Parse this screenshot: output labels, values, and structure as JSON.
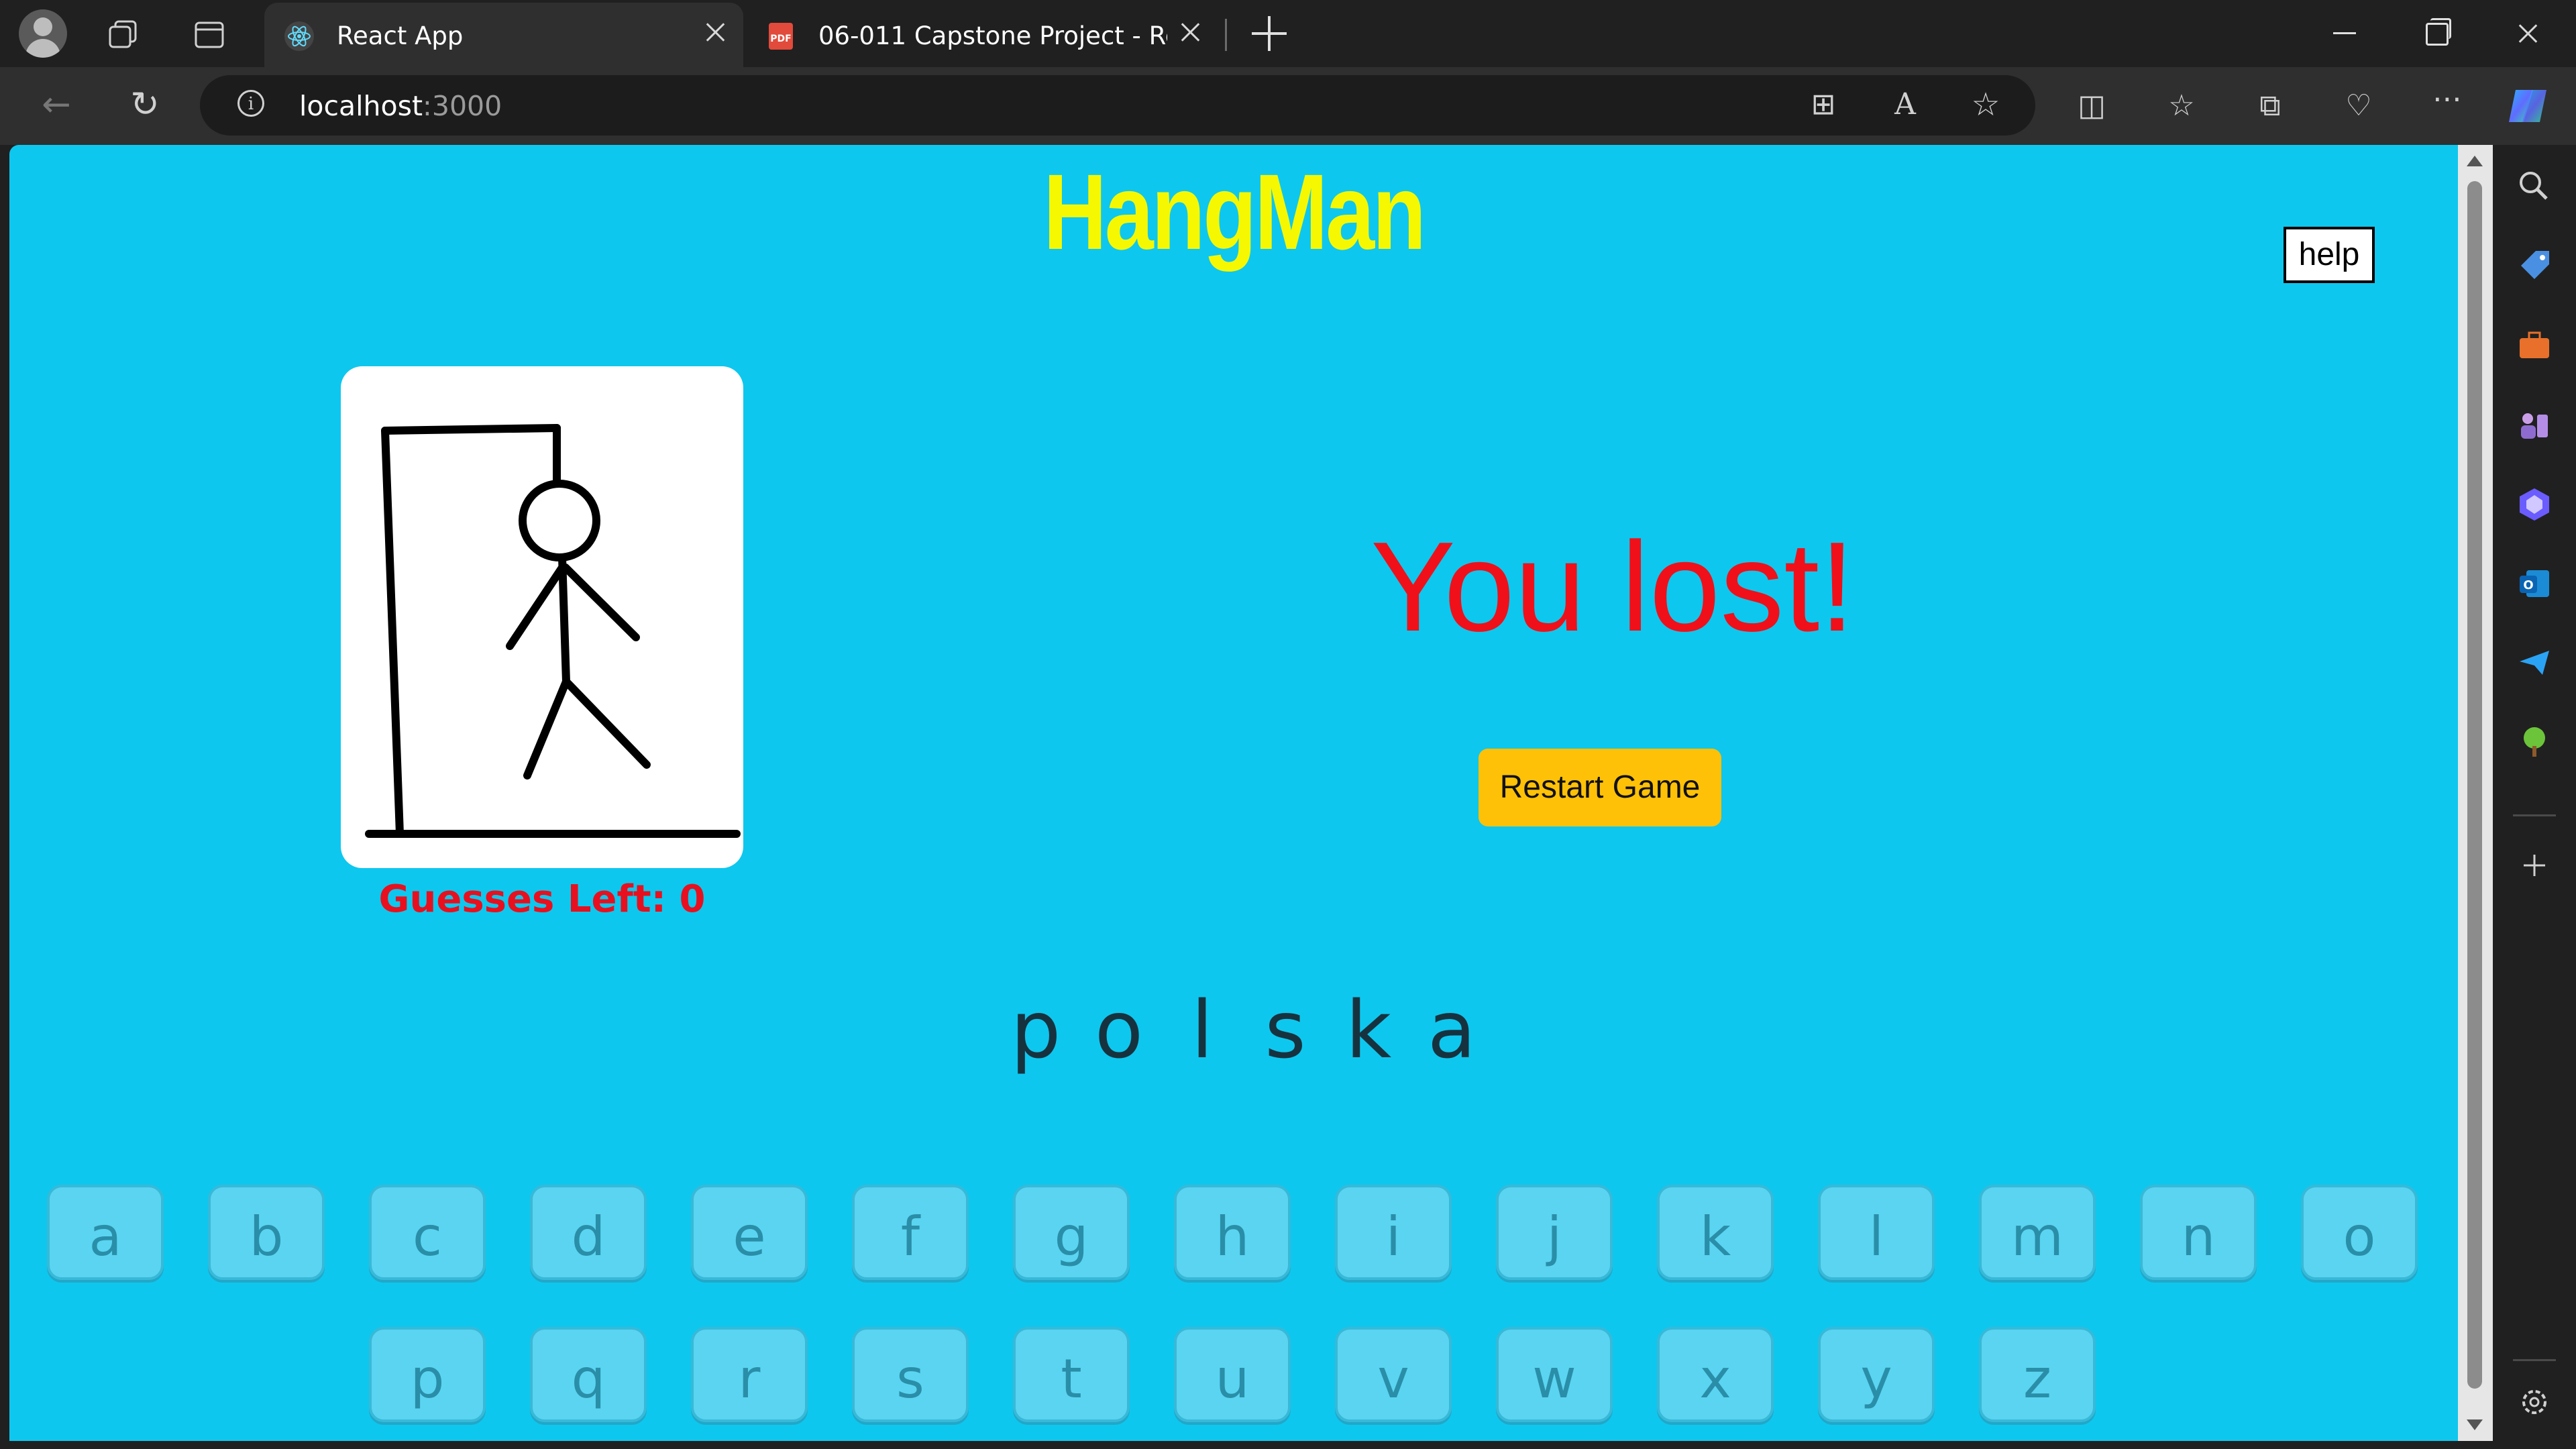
{
  "browser": {
    "tabs": [
      {
        "label": "React App",
        "active": true,
        "icon": "react-icon"
      },
      {
        "label": "06-011 Capstone Project - React",
        "active": false,
        "icon": "pdf-icon"
      }
    ],
    "address": {
      "host": "localhost",
      "port": ":3000"
    },
    "sidebar_icons": [
      "search-icon",
      "tag-icon",
      "briefcase-icon",
      "games-icon",
      "copilot-icon",
      "outlook-icon",
      "send-icon",
      "tree-icon",
      "add-icon",
      "settings-icon"
    ]
  },
  "game": {
    "title": "HangMan",
    "help_label": "help",
    "guesses_label": "Guesses Left: 0",
    "result": "You lost!",
    "restart_label": "Restart Game",
    "word": [
      "p",
      "o",
      "l",
      "s",
      "k",
      "a"
    ],
    "keyboard_row1": [
      "a",
      "b",
      "c",
      "d",
      "e",
      "f",
      "g",
      "h",
      "i",
      "j",
      "k",
      "l",
      "m",
      "n",
      "o"
    ],
    "keyboard_row2": [
      "p",
      "q",
      "r",
      "s",
      "t",
      "u",
      "v",
      "w",
      "x",
      "y",
      "z"
    ]
  },
  "colors": {
    "page_bg": "#0ec7ee",
    "title": "#f5f800",
    "result": "#f0101a",
    "restart_button": "#ffc107",
    "key_disabled": "#5ad4f1"
  }
}
